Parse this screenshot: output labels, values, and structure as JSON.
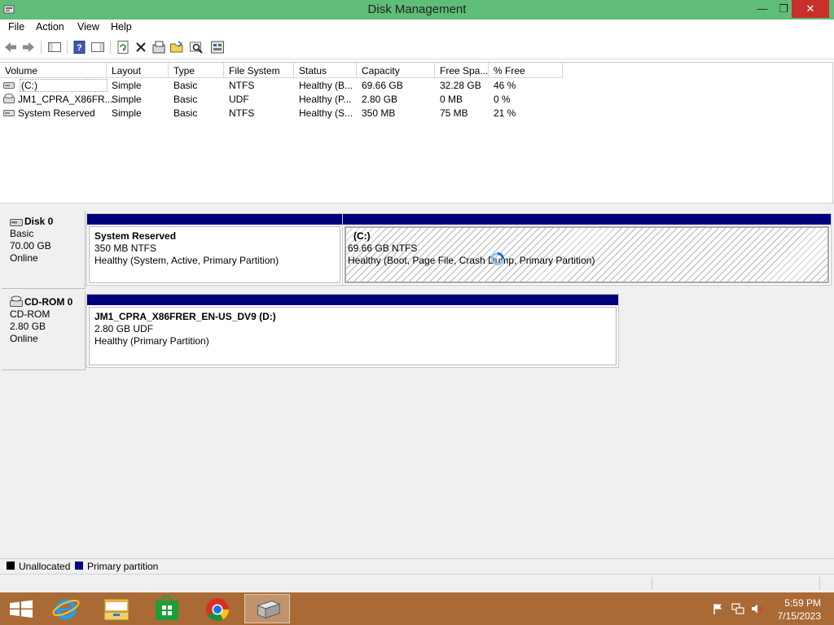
{
  "window": {
    "title": "Disk Management",
    "minimize": "—",
    "restore": "❐",
    "close": "✕"
  },
  "menu": [
    "File",
    "Action",
    "View",
    "Help"
  ],
  "toolbar": [
    "back-icon",
    "forward-icon",
    "console-tree-icon",
    "help-icon",
    "show-hide-icon",
    "refresh-icon",
    "delete-icon",
    "properties-icon",
    "open-icon",
    "explore-icon",
    "help-topics-icon"
  ],
  "volume_list": {
    "columns": [
      "Volume",
      "Layout",
      "Type",
      "File System",
      "Status",
      "Capacity",
      "Free Spa...",
      "% Free"
    ],
    "rows": [
      {
        "volume": "(C:)",
        "layout": "Simple",
        "type": "Basic",
        "fs": "NTFS",
        "status": "Healthy (B...",
        "capacity": "69.66 GB",
        "free": "32.28 GB",
        "pct": "46 %",
        "icon": "drive-icon"
      },
      {
        "volume": "JM1_CPRA_X86FR...",
        "layout": "Simple",
        "type": "Basic",
        "fs": "UDF",
        "status": "Healthy (P...",
        "capacity": "2.80 GB",
        "free": "0 MB",
        "pct": "0 %",
        "icon": "cdrom-icon"
      },
      {
        "volume": "System Reserved",
        "layout": "Simple",
        "type": "Basic",
        "fs": "NTFS",
        "status": "Healthy (S...",
        "capacity": "350 MB",
        "free": "75 MB",
        "pct": "21 %",
        "icon": "drive-icon"
      }
    ]
  },
  "disks": [
    {
      "name": "Disk 0",
      "type": "Basic",
      "size": "70.00 GB",
      "state": "Online",
      "icon": "hard-disk-icon",
      "partitions": [
        {
          "title": "System Reserved",
          "size": "350 MB NTFS",
          "status": "Healthy (System, Active, Primary Partition)"
        },
        {
          "title": "(C:)",
          "size": "69.66 GB NTFS",
          "status": "Healthy (Boot, Page File, Crash Dump, Primary Partition)"
        }
      ]
    },
    {
      "name": "CD-ROM 0",
      "type": "CD-ROM",
      "size": "2.80 GB",
      "state": "Online",
      "icon": "cdrom-icon",
      "partitions": [
        {
          "title": "JM1_CPRA_X86FRER_EN-US_DV9  (D:)",
          "size": "2.80 GB UDF",
          "status": "Healthy (Primary Partition)"
        }
      ]
    }
  ],
  "legend": [
    {
      "label": "Unallocated",
      "color": "#000000"
    },
    {
      "label": "Primary partition",
      "color": "#00007c"
    }
  ],
  "colors": {
    "titlebar": "#5fbd79",
    "partition_bar": "#00007c",
    "taskbar": "#a96a35",
    "close_button": "#c7302b"
  },
  "taskbar": {
    "apps": [
      "start-icon",
      "internet-explorer-icon",
      "file-explorer-icon",
      "store-icon",
      "chrome-icon",
      "disk-management-icon"
    ],
    "tray": [
      "action-center-flag-icon",
      "network-icon",
      "volume-muted-icon"
    ],
    "clock": {
      "time": "5:59 PM",
      "date": "7/15/2023"
    }
  }
}
